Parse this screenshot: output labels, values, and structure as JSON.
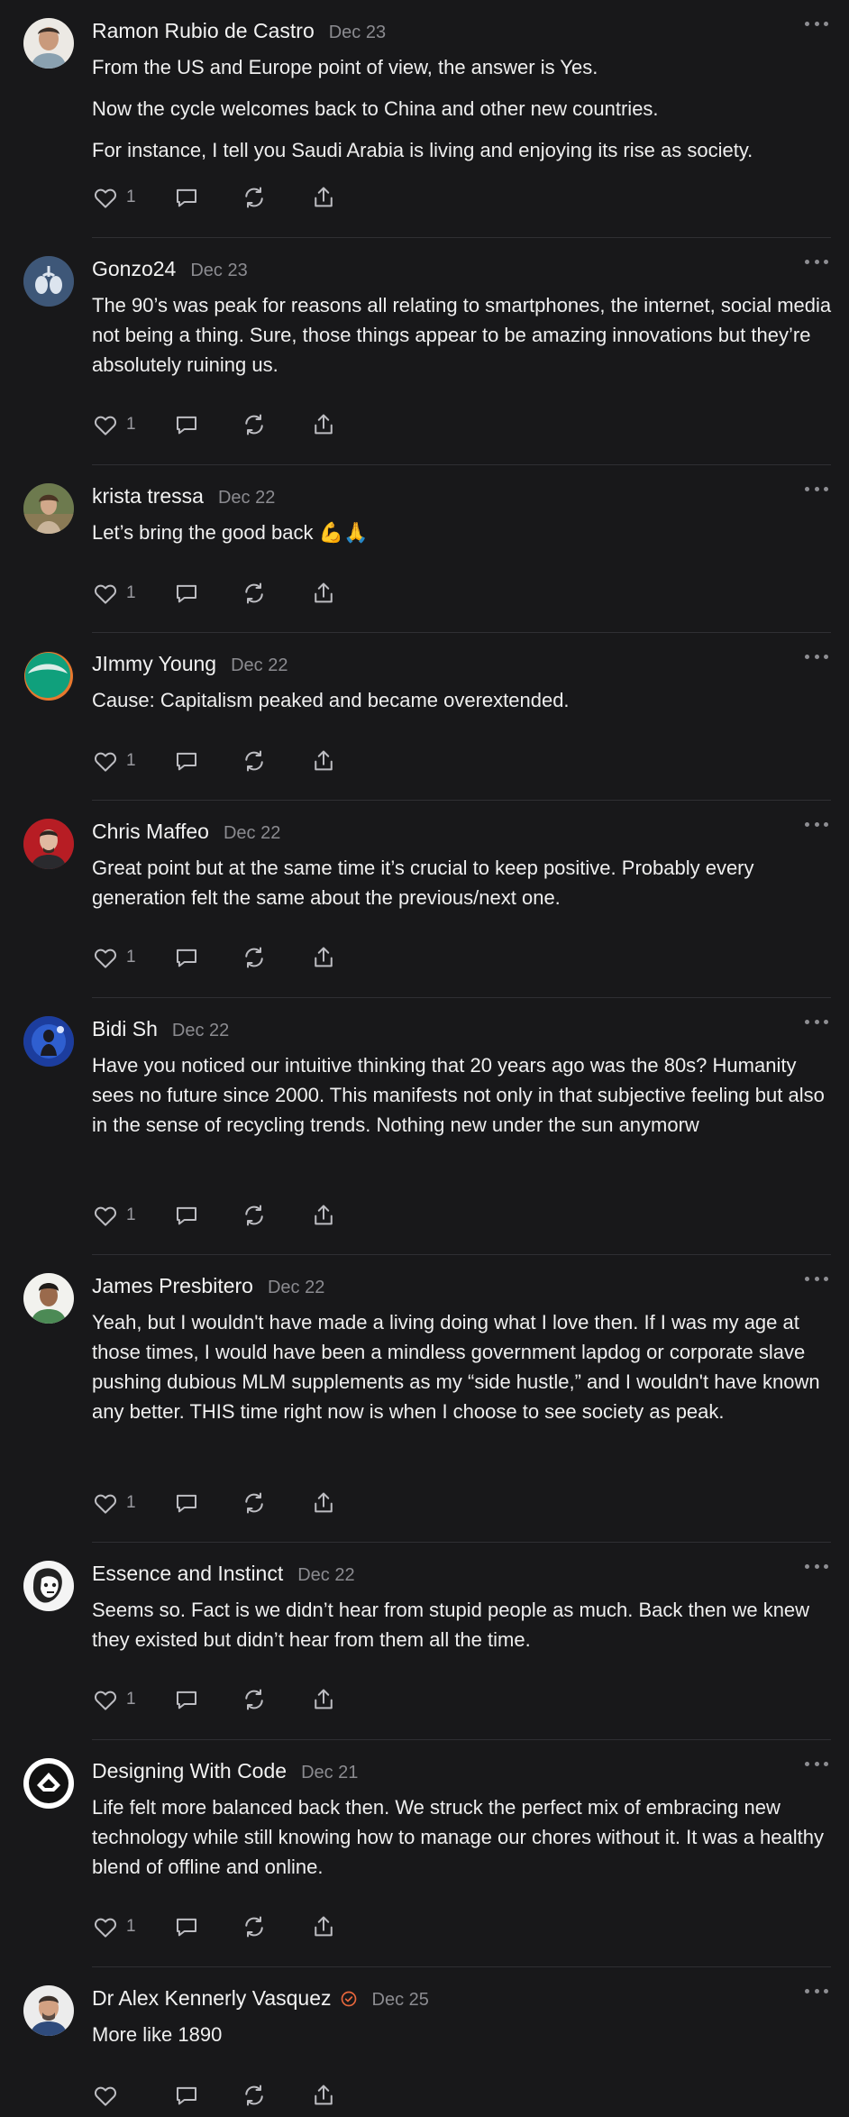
{
  "colors": {
    "background": "#18181a",
    "text": "#efefef",
    "muted": "#8b8b90",
    "divider": "#2f2f33",
    "verified": "#e8673c"
  },
  "icons": {
    "like": "heart-icon",
    "reply": "comment-bubble-icon",
    "restack": "restack-arrows-icon",
    "share": "share-upload-icon",
    "more": "more-dots-icon",
    "verified": "verified-check-icon"
  },
  "comments": [
    {
      "author": "Ramon Rubio de Castro",
      "date": "Dec 23",
      "likes": "1",
      "paragraphs": [
        "From the US and Europe point of view, the answer is Yes.",
        "Now the cycle welcomes back to China and other new countries.",
        "For instance, I tell you Saudi Arabia is living and enjoying its rise as society."
      ]
    },
    {
      "author": "Gonzo24",
      "date": "Dec 23",
      "likes": "1",
      "paragraphs": [
        "The 90’s was peak for reasons all relating to smartphones, the internet, social media not being a thing. Sure, those things appear to be amazing innovations but they’re absolutely ruining us."
      ]
    },
    {
      "author": "krista tressa",
      "date": "Dec 22",
      "likes": "1",
      "paragraphs": [
        "Let’s bring the good back 💪🙏"
      ]
    },
    {
      "author": "JImmy Young",
      "date": "Dec 22",
      "likes": "1",
      "paragraphs": [
        "Cause: Capitalism peaked and became overextended."
      ]
    },
    {
      "author": "Chris Maffeo",
      "date": "Dec 22",
      "likes": "1",
      "paragraphs": [
        "Great point but at the same time it’s crucial to keep positive. Probably every generation felt the same about the previous/next one."
      ]
    },
    {
      "author": "Bidi Sh",
      "date": "Dec 22",
      "likes": "1",
      "paragraphs": [
        "Have you noticed our intuitive thinking that 20 years ago was the 80s? Humanity sees no future since 2000. This manifests not only in that subjective feeling but also in the sense of recycling trends. Nothing new under the sun anymorw"
      ]
    },
    {
      "author": "James Presbitero",
      "date": "Dec 22",
      "likes": "1",
      "paragraphs": [
        "Yeah, but I wouldn't have made a living doing what I love then. If I was my age at those times, I would have been a mindless government lapdog or corporate slave pushing dubious MLM supplements as my “side hustle,” and I wouldn't have known any better. THIS time right now is when I choose to see society as peak."
      ]
    },
    {
      "author": "Essence and Instinct",
      "date": "Dec 22",
      "likes": "1",
      "paragraphs": [
        "Seems so. Fact is we didn’t hear from stupid people as much. Back then we knew they existed but didn’t hear from them all the time."
      ]
    },
    {
      "author": "Designing With Code",
      "date": "Dec 21",
      "likes": "1",
      "paragraphs": [
        "Life felt more balanced back then. We struck the perfect mix of embracing new technology while still knowing how to manage our chores without it. It was a healthy blend of offline and online."
      ]
    },
    {
      "author": "Dr Alex Kennerly Vasquez",
      "date": "Dec 25",
      "likes": "",
      "verified": true,
      "paragraphs": [
        "More like 1890"
      ]
    }
  ]
}
